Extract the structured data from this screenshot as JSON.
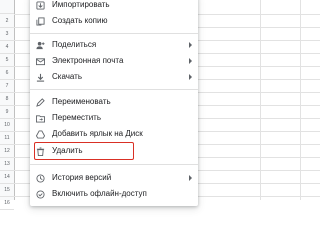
{
  "sheet": {
    "row_numbers": [
      "",
      "2",
      "3",
      "4",
      "5",
      "6",
      "7",
      "8",
      "9",
      "10",
      "11",
      "12",
      "13",
      "14",
      "15",
      "16"
    ]
  },
  "menu": {
    "items": [
      {
        "label": "Импортировать",
        "icon": "import-icon",
        "submenu": false
      },
      {
        "label": "Создать копию",
        "icon": "copy-icon",
        "submenu": false
      },
      {
        "label": "Поделиться",
        "icon": "share-person-add-icon",
        "submenu": true
      },
      {
        "label": "Электронная почта",
        "icon": "email-icon",
        "submenu": true
      },
      {
        "label": "Скачать",
        "icon": "download-icon",
        "submenu": true
      },
      {
        "label": "Переименовать",
        "icon": "rename-icon",
        "submenu": false
      },
      {
        "label": "Переместить",
        "icon": "move-folder-icon",
        "submenu": false
      },
      {
        "label": "Добавить ярлык на Диск",
        "icon": "drive-shortcut-icon",
        "submenu": false
      },
      {
        "label": "Удалить",
        "icon": "trash-icon",
        "submenu": false
      },
      {
        "label": "История версий",
        "icon": "history-icon",
        "submenu": true
      },
      {
        "label": "Включить офлайн-доступ",
        "icon": "offline-icon",
        "submenu": false
      }
    ],
    "highlight_color": "#d93025"
  }
}
